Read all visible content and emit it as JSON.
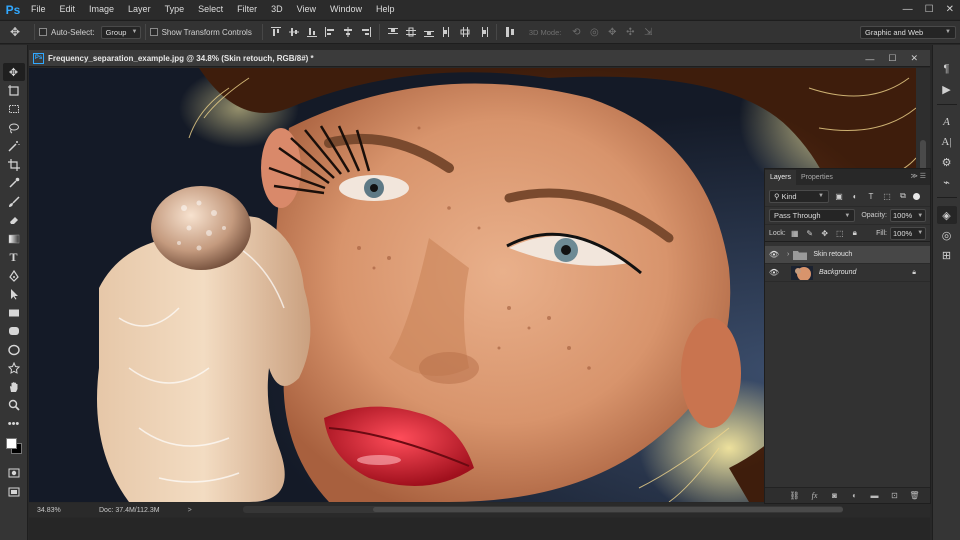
{
  "app": {
    "logo": "Ps",
    "accent": "#31a8ff"
  },
  "menu": [
    "File",
    "Edit",
    "Image",
    "Layer",
    "Type",
    "Select",
    "Filter",
    "3D",
    "View",
    "Window",
    "Help"
  ],
  "window_controls": {
    "minimize": "—",
    "maximize": "☐",
    "close": "✕"
  },
  "options": {
    "auto_select_label": "Auto-Select:",
    "auto_select_value": "Group",
    "show_transform_label": "Show Transform Controls",
    "mode3d_label": "3D Mode:",
    "workspace": "Graphic and Web"
  },
  "document": {
    "title": "Frequency_separation_example.jpg @ 34.8% (Skin retouch, RGB/8#) *",
    "zoom": "34.83%",
    "doc_info": "Doc: 37.4M/112.3M",
    "status_arrow": ">"
  },
  "tools": [
    "move-tool",
    "artboard-tool",
    "marquee-tool",
    "lasso-tool",
    "quick-select-tool",
    "crop-tool",
    "eyedropper-tool",
    "brush-tool",
    "eraser-tool",
    "gradient-tool",
    "type-tool",
    "pen-tool",
    "path-select-tool",
    "rectangle-tool",
    "rounded-rect-tool",
    "ellipse-tool",
    "custom-shape-tool",
    "hand-tool",
    "zoom-tool",
    "more-tools"
  ],
  "colors": {
    "foreground": "#ffffff",
    "background": "#000000"
  },
  "layers_panel": {
    "tabs": [
      "Layers",
      "Properties"
    ],
    "kind_filter": "Kind",
    "blend_mode": "Pass Through",
    "opacity_label": "Opacity:",
    "opacity_value": "100%",
    "lock_label": "Lock:",
    "fill_label": "Fill:",
    "fill_value": "100%",
    "layers": [
      {
        "name": "Skin retouch",
        "type": "group",
        "visible": true,
        "selected": true
      },
      {
        "name": "Background",
        "type": "image",
        "visible": true,
        "selected": false,
        "locked": true
      }
    ]
  }
}
